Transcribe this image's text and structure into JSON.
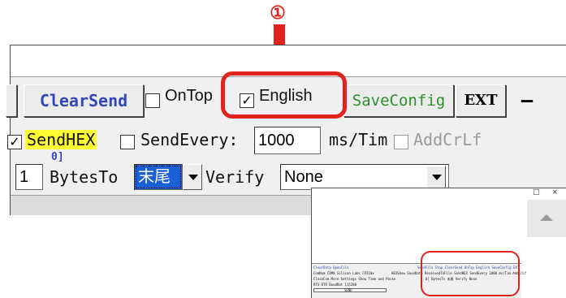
{
  "annotation": {
    "step": "①"
  },
  "toolbar": {
    "clearsend_label": "ClearSend",
    "ontop_label": "OnTop",
    "english_label": "English",
    "saveconfig_label": "SaveConfig",
    "ext_label": "EXT",
    "dash_label": "—"
  },
  "send_row": {
    "sendhex_label": "SendHEX",
    "sendevery_label": "SendEvery:",
    "interval_value": "1000",
    "unit_label": "ms/Tim",
    "addcrlf_label": "AddCrLf"
  },
  "verify_row": {
    "prefix_label": "0]",
    "left_value": "1",
    "bytesto_label": "BytesTo",
    "bytesto_value": "末尾",
    "verify_label": "Verify",
    "verify_value": "None"
  },
  "thumbnail": {
    "window_controls": "□ ×",
    "row1": "ClearData OpenFile ",
    "row1b": "SendFile Stop ClearSend OnTop English SaveConfig EXT",
    "row2": "ComNum COM8 Silicon Labs CP210x",
    "row2b": "HEXShow SaveData ReceivedToFile SendHEX SendEvery 1000 ms/Tim AddCrLf",
    "row3": "CloseCom More Settings Show Time and Packe",
    "row3b": "0] BytesTo 末尾 Verify None",
    "row4": "RTS DTR BaudRat 115200",
    "row5": "SEND"
  },
  "colors": {
    "accent_red": "#e0231c",
    "sendhex_bg": "#ffff33",
    "link_blue": "#3346b8",
    "saveconfig_green": "#2f8f2f",
    "selection_blue": "#1a5fd6"
  }
}
